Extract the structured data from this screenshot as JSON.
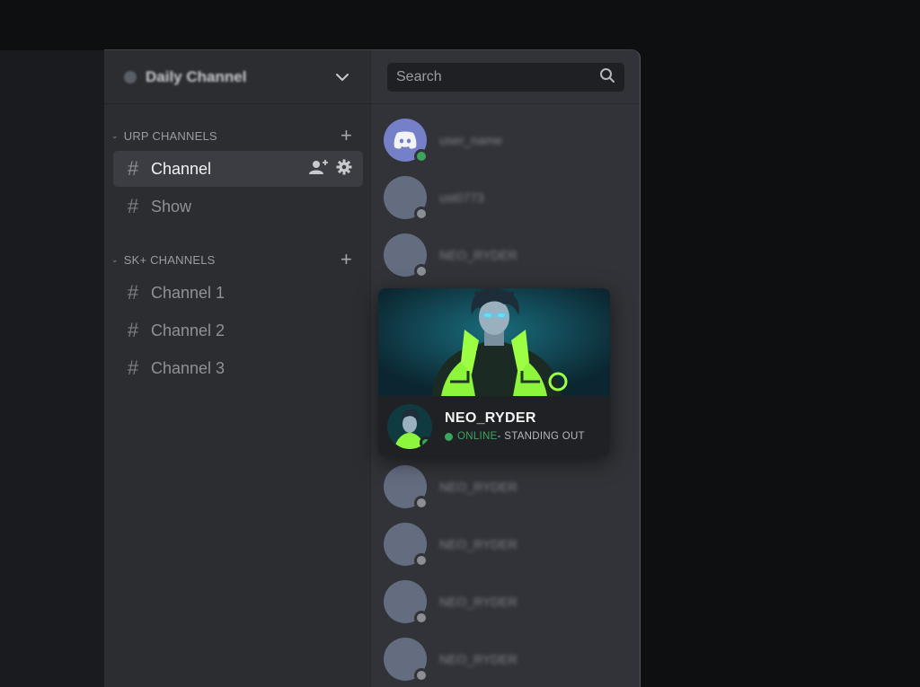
{
  "server": {
    "name": "Daily Channel"
  },
  "categories": [
    {
      "label": "URP CHANNELS",
      "channels": [
        {
          "label": "Channel",
          "active": true
        },
        {
          "label": "Show",
          "active": false
        }
      ]
    },
    {
      "label": "SK+ CHANNELS",
      "channels": [
        {
          "label": "Channel 1"
        },
        {
          "label": "Channel 2"
        },
        {
          "label": "Channel 3"
        }
      ]
    }
  ],
  "search": {
    "placeholder": "Search"
  },
  "members": [
    {
      "name": "user_name",
      "status": "online",
      "avatar": "discord-logo"
    },
    {
      "name": "ust0773",
      "status": "offline"
    },
    {
      "name": "NEO_RYDER",
      "status": "offline"
    },
    {
      "name": "NEO_RYDER",
      "status": "offline"
    },
    {
      "name": "NEO_RYDER",
      "status": "offline"
    },
    {
      "name": "NEO_RYDER",
      "status": "offline"
    },
    {
      "name": "NEO_RYDER",
      "status": "offline"
    }
  ],
  "profile_card": {
    "name": "NEO_RYDER",
    "status_word": "ONLINE",
    "status_text": " - STANDING OUT"
  },
  "colors": {
    "online": "#3ba55c",
    "accent_neon": "#7dff3a",
    "eye_glow": "#3fd7ff"
  }
}
